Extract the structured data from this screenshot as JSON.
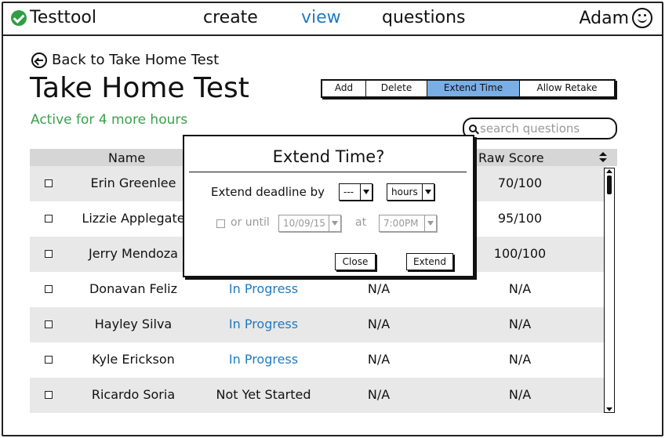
{
  "app": {
    "brand": "Testtool",
    "nav": {
      "create": "create",
      "view": "view",
      "questions": "questions"
    },
    "user": "Adam"
  },
  "page": {
    "back_link": "Back to Take Home Test",
    "title": "Take Home Test",
    "status": "Active for 4 more hours",
    "status_color": "#3aa14a"
  },
  "toolbar": {
    "add": "Add",
    "delete": "Delete",
    "extend": "Extend Time",
    "retake": "Allow Retake",
    "active_color": "#7aaee6"
  },
  "search": {
    "placeholder": "search questions"
  },
  "table": {
    "headers": {
      "name": "Name",
      "raw_score": "Raw Score"
    },
    "rows": [
      {
        "name": "Erin Greenlee",
        "status": "",
        "time": "",
        "score": "70/100"
      },
      {
        "name": "Lizzie Applegate",
        "status": "",
        "time": "",
        "score": "95/100"
      },
      {
        "name": "Jerry Mendoza",
        "status": "",
        "time": "",
        "score": "100/100"
      },
      {
        "name": "Donavan Feliz",
        "status": "In Progress",
        "time": "N/A",
        "score": "N/A"
      },
      {
        "name": "Hayley Silva",
        "status": "In Progress",
        "time": "N/A",
        "score": "N/A"
      },
      {
        "name": "Kyle Erickson",
        "status": "In Progress",
        "time": "N/A",
        "score": "N/A"
      },
      {
        "name": "Ricardo Soria",
        "status": "Not Yet Started",
        "time": "N/A",
        "score": "N/A"
      }
    ]
  },
  "modal": {
    "title": "Extend Time?",
    "deadline_label": "Extend deadline by",
    "amount": "---",
    "unit": "hours",
    "until_label": "or until",
    "date": "10/09/15",
    "at_label": "at",
    "time": "7:00PM",
    "close": "Close",
    "extend": "Extend"
  },
  "colors": {
    "link": "#1f7bc1",
    "row_alt": "#e8e8e8",
    "header_bg": "#d6d6d6"
  }
}
